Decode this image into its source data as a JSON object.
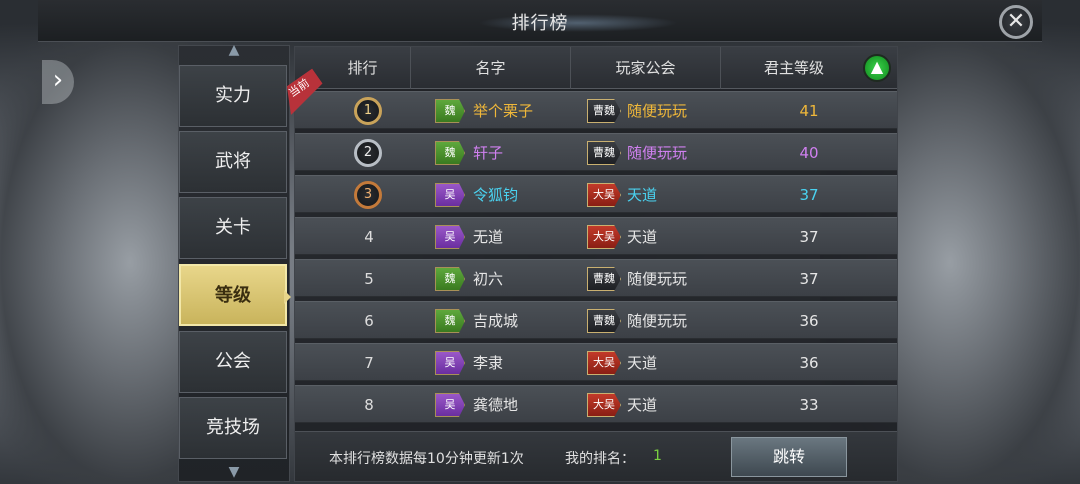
{
  "window": {
    "title": "排行榜"
  },
  "tabs": [
    {
      "label": "实力",
      "active": false
    },
    {
      "label": "武将",
      "active": false
    },
    {
      "label": "关卡",
      "active": false
    },
    {
      "label": "等级",
      "active": true
    },
    {
      "label": "公会",
      "active": false
    },
    {
      "label": "竞技场",
      "active": false
    }
  ],
  "table": {
    "headers": {
      "rank": "排行",
      "name": "名字",
      "guild": "玩家公会",
      "level": "君主等级"
    },
    "current_label": "当前",
    "rows": [
      {
        "rank": "1",
        "faction": "魏",
        "name": "举个栗子",
        "guild_tag": "曹魏",
        "guild": "随便玩玩",
        "level": "41",
        "color": "#f0b83a"
      },
      {
        "rank": "2",
        "faction": "魏",
        "name": "轩子",
        "guild_tag": "曹魏",
        "guild": "随便玩玩",
        "level": "40",
        "color": "#d080f0"
      },
      {
        "rank": "3",
        "faction": "吴",
        "name": "令狐钧",
        "guild_tag": "大吴",
        "guild": "天道",
        "level": "37",
        "color": "#4ad2f0"
      },
      {
        "rank": "4",
        "faction": "吴",
        "name": "无道",
        "guild_tag": "大吴",
        "guild": "天道",
        "level": "37",
        "color": "#e6e6e6"
      },
      {
        "rank": "5",
        "faction": "魏",
        "name": "初六",
        "guild_tag": "曹魏",
        "guild": "随便玩玩",
        "level": "37",
        "color": "#e6e6e6"
      },
      {
        "rank": "6",
        "faction": "魏",
        "name": "吉成城",
        "guild_tag": "曹魏",
        "guild": "随便玩玩",
        "level": "36",
        "color": "#e6e6e6"
      },
      {
        "rank": "7",
        "faction": "吴",
        "name": "李隶",
        "guild_tag": "大吴",
        "guild": "天道",
        "level": "36",
        "color": "#e6e6e6"
      },
      {
        "rank": "8",
        "faction": "吴",
        "name": "龚德地",
        "guild_tag": "大吴",
        "guild": "天道",
        "level": "33",
        "color": "#e6e6e6"
      }
    ]
  },
  "footer": {
    "note": "本排行榜数据每10分钟更新1次",
    "my_rank_label": "我的排名：",
    "my_rank_value": "1",
    "jump_label": "跳转"
  },
  "icons": {
    "close": "close-icon",
    "up": "up-arrow-icon",
    "side_arrow": "chevron-right-icon"
  }
}
